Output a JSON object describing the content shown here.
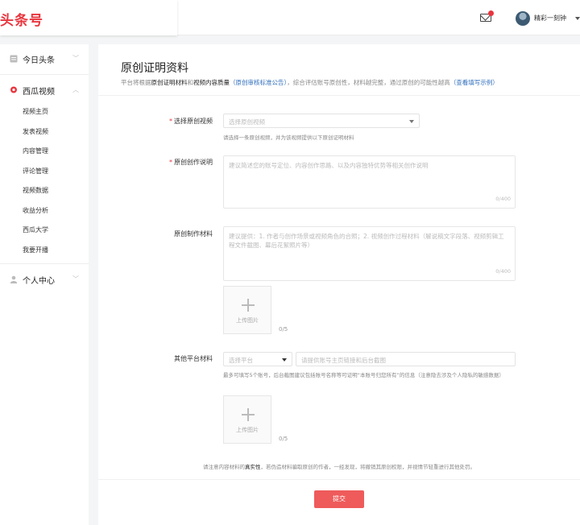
{
  "header": {
    "logo": "头条号",
    "user_name": "精彩一刻钟"
  },
  "sidebar": {
    "groups": [
      {
        "label": "今日头条",
        "icon": "document-icon"
      },
      {
        "label": "西瓜视频",
        "icon": "location-icon"
      },
      {
        "label": "个人中心",
        "icon": "person-icon"
      }
    ],
    "video_items": [
      "视频主页",
      "发表视频",
      "内容管理",
      "评论管理",
      "视频数据",
      "收益分析",
      "西瓜大学",
      "我要开播"
    ]
  },
  "main": {
    "title": "原创证明资料",
    "subtitle": {
      "part1": "平台将根据",
      "bold1": "原创证明材料",
      "part2": "和",
      "bold2": "视频内容质量",
      "link1": "（原创审核标准公告）",
      "part3": "，综合评估账号原创性，材料越完整，通过原创的可能性越高",
      "link2": "（查看填写示例）"
    },
    "fields": {
      "select_video": {
        "label": "选择原创视频",
        "placeholder": "选择原创视频",
        "hint": "请选择一条原创视频，并为该视频提供以下原创证明材料"
      },
      "description": {
        "label": "原创创作说明",
        "placeholder": "建议简述您的账号定位、内容创作思路、以及内容独特优势等相关创作说明",
        "counter": "0/400"
      },
      "materials": {
        "label": "原创制作材料",
        "placeholder": "建议提供：1. 作者与创作场景或视频角色的合照；2. 视频创作过程材料（解说稿文字段落、视频剪辑工程文件截图、幕后花絮照片等）",
        "counter": "0/400",
        "upload_label": "上传图片",
        "upload_count": "0/5"
      },
      "other_platform": {
        "label": "其他平台材料",
        "select_placeholder": "选择平台",
        "input_placeholder": "请提供账号主页链接和后台截图",
        "hint": "最多可填写5个账号，后台截图建议包括账号名称等可证明“本账号归您所有”的信息（注意隐去涉及个人隐私的敏感数据）",
        "upload_label": "上传图片",
        "upload_count": "0/5"
      }
    },
    "notice": {
      "part1": "请注意内容材料的",
      "bold": "真实性",
      "part2": "，若伪造材料骗取原创的作者，一经发现，将撤销其原创权限，并视情节轻重进行其他处罚。"
    },
    "submit_label": "提交"
  },
  "colors": {
    "brand": "#e8353e",
    "submit": "#ef5b5b",
    "link": "#2f6ebd"
  }
}
